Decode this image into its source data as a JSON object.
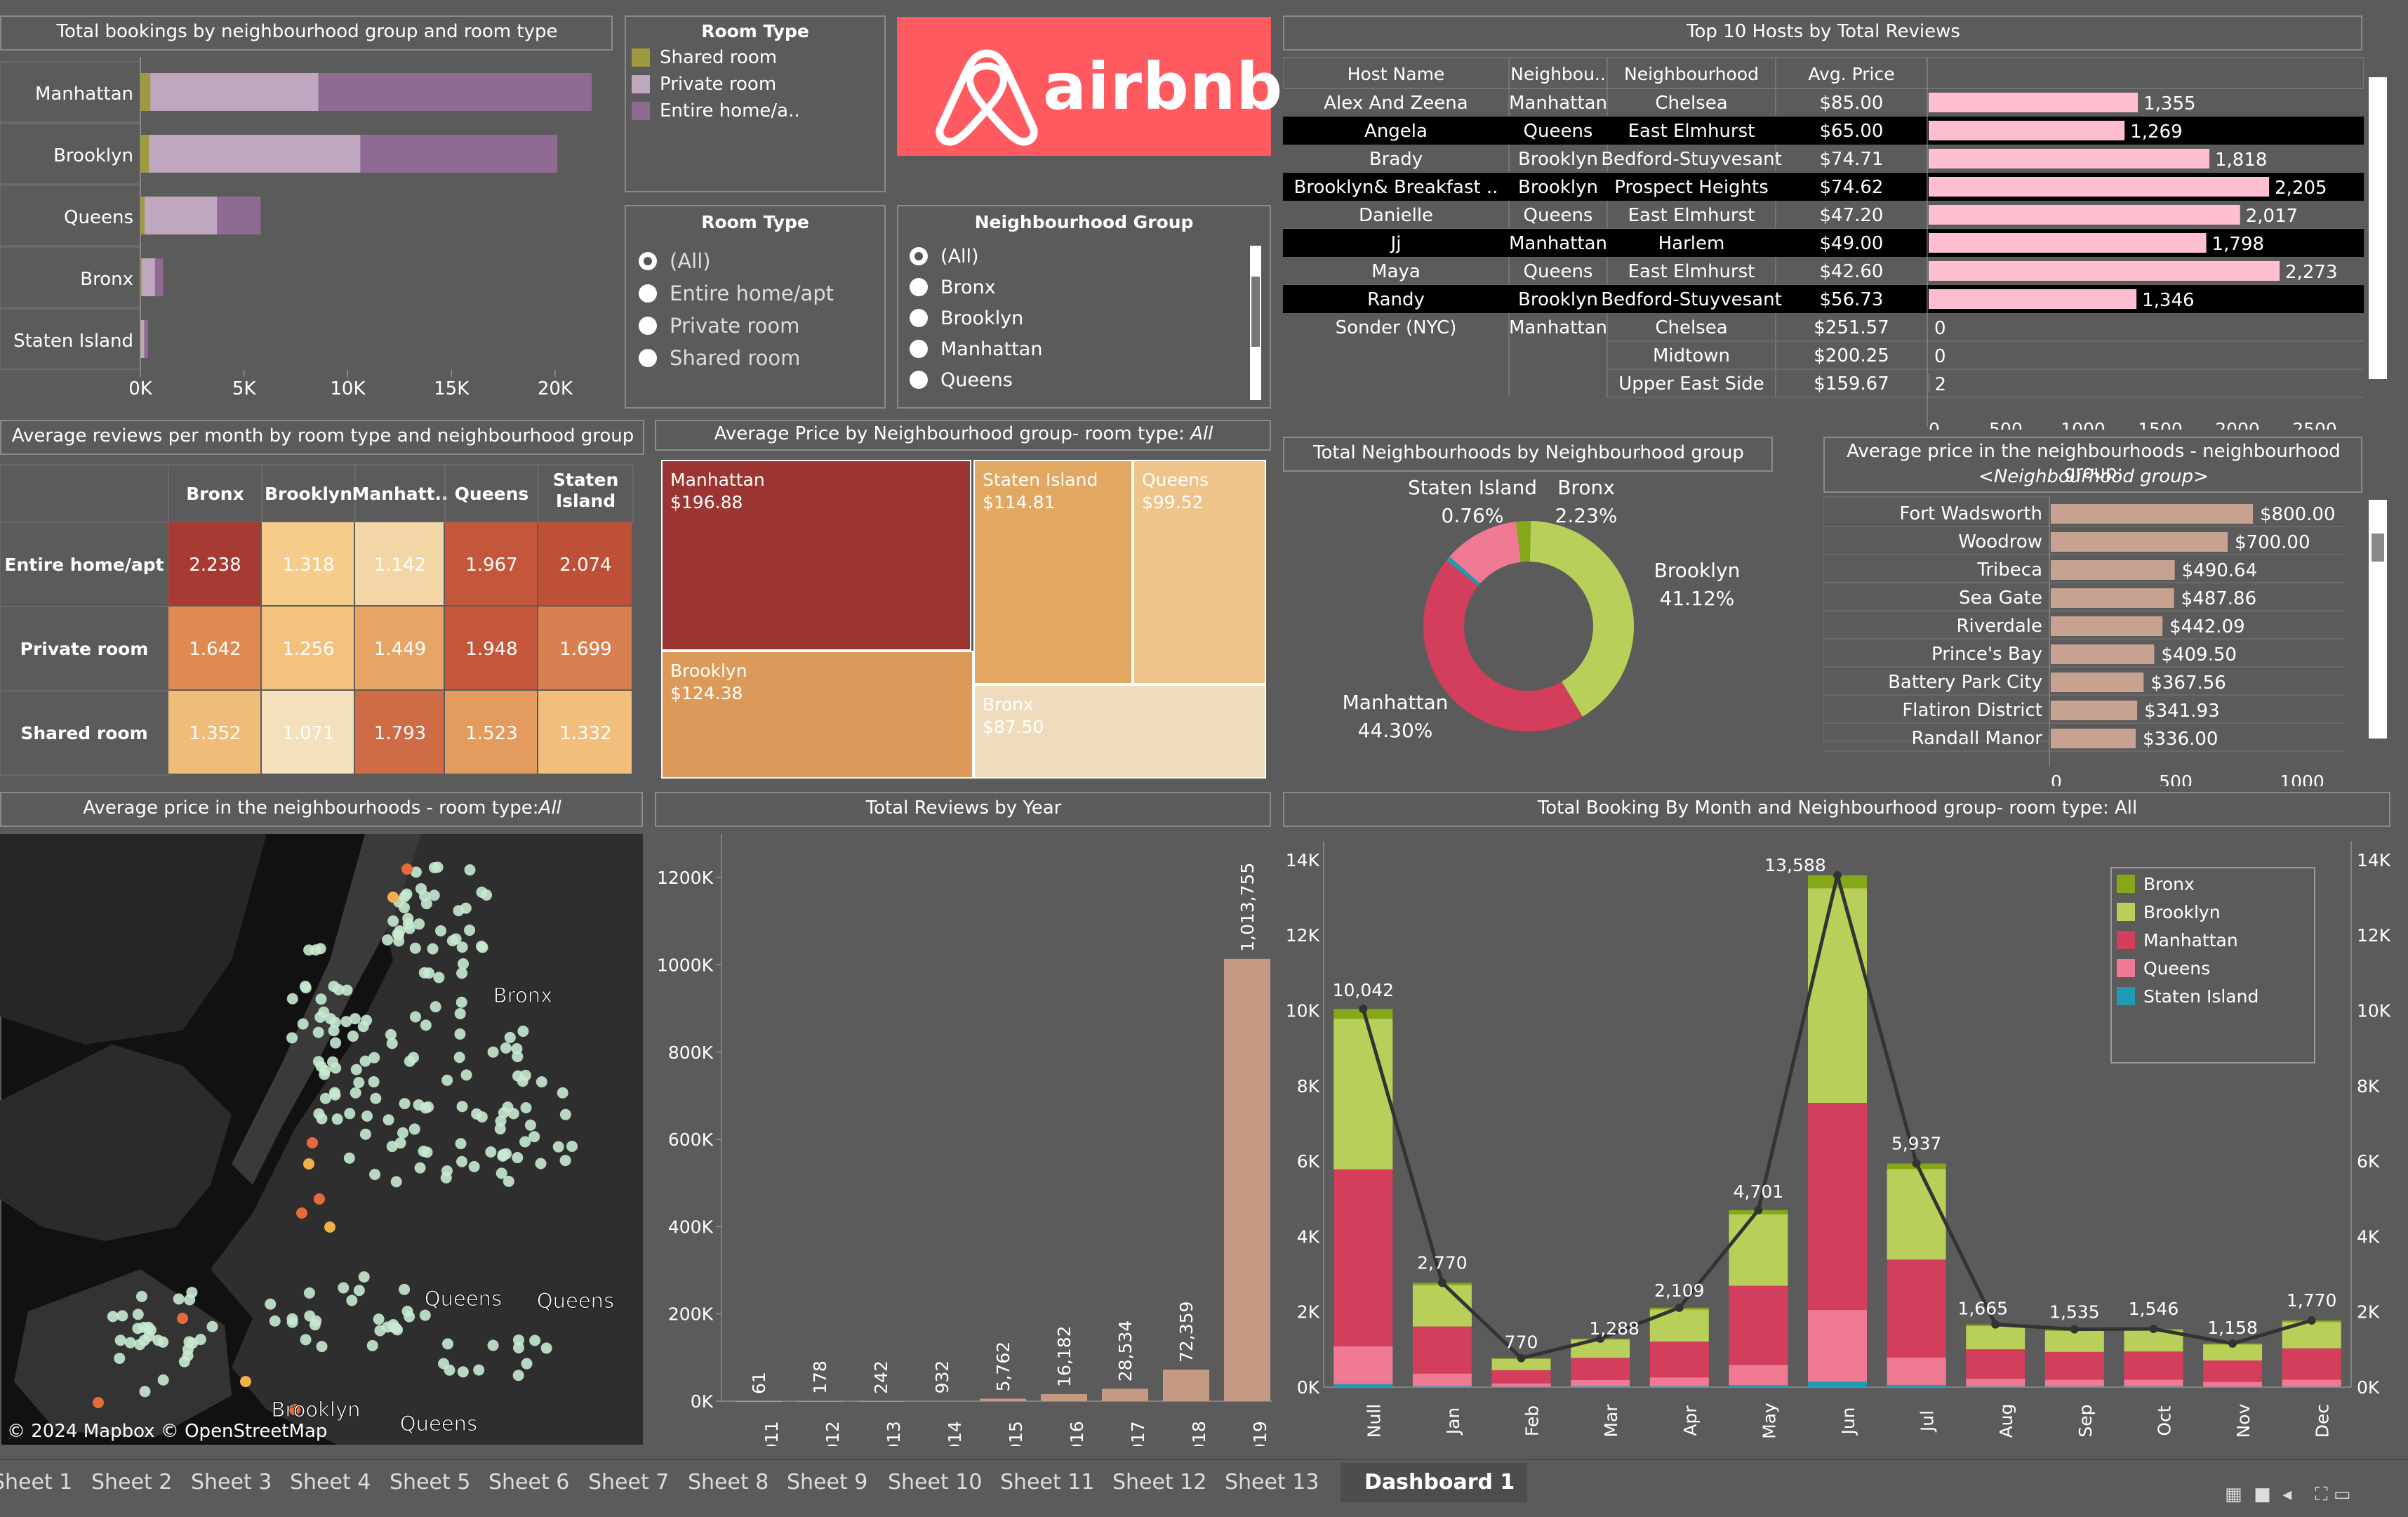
{
  "bookings": {
    "title": "Total bookings by neighbourhood group and room type",
    "legend_title": "Room Type",
    "legend": [
      "Shared room",
      "Private room",
      "Entire home/a.."
    ],
    "legend_colors": [
      "#9c9a3c",
      "#bfa7c0",
      "#8f6a92"
    ],
    "ticks": [
      "0K",
      "5K",
      "10K",
      "15K",
      "20K"
    ]
  },
  "logo": {
    "text": "airbnb",
    "bg": "#ff5a5f"
  },
  "filter_room": {
    "title": "Room Type",
    "options": [
      "(All)",
      "Entire home/apt",
      "Private room",
      "Shared room"
    ],
    "selected": "(All)"
  },
  "filter_group": {
    "title": "Neighbourhood Group",
    "options": [
      "(All)",
      "Bronx",
      "Brooklyn",
      "Manhattan",
      "Queens"
    ],
    "selected": "(All)"
  },
  "top_hosts": {
    "title": "Top 10 Hosts by Total Reviews",
    "columns": [
      "Host Name",
      "Neighbou..",
      "Neighbourhood",
      "Avg. Price"
    ],
    "rows": [
      {
        "host": "Alex And Zeena",
        "group": "Manhattan",
        "hood": "Chelsea",
        "price": "$85.00",
        "reviews": "1,355",
        "v": 1355,
        "dark": false
      },
      {
        "host": "Angela",
        "group": "Queens",
        "hood": "East Elmhurst",
        "price": "$65.00",
        "reviews": "1,269",
        "v": 1269,
        "dark": true
      },
      {
        "host": "Brady",
        "group": "Brooklyn",
        "hood": "Bedford-Stuyvesant",
        "price": "$74.71",
        "reviews": "1,818",
        "v": 1818,
        "dark": false
      },
      {
        "host": "Brooklyn&  Breakfast  ..",
        "group": "Brooklyn",
        "hood": "Prospect Heights",
        "price": "$74.62",
        "reviews": "2,205",
        "v": 2205,
        "dark": true
      },
      {
        "host": "Danielle",
        "group": "Queens",
        "hood": "East Elmhurst",
        "price": "$47.20",
        "reviews": "2,017",
        "v": 2017,
        "dark": false
      },
      {
        "host": "Jj",
        "group": "Manhattan",
        "hood": "Harlem",
        "price": "$49.00",
        "reviews": "1,798",
        "v": 1798,
        "dark": true
      },
      {
        "host": "Maya",
        "group": "Queens",
        "hood": "East Elmhurst",
        "price": "$42.60",
        "reviews": "2,273",
        "v": 2273,
        "dark": false
      },
      {
        "host": "Randy",
        "group": "Brooklyn",
        "hood": "Bedford-Stuyvesant",
        "price": "$56.73",
        "reviews": "1,346",
        "v": 1346,
        "dark": true
      },
      {
        "host": "Sonder (NYC)",
        "group": "Manhattan",
        "hood": "Chelsea",
        "price": "$251.57",
        "reviews": "0",
        "v": 0,
        "dark": false
      },
      {
        "host": "",
        "group": "",
        "hood": "Midtown",
        "price": "$200.25",
        "reviews": "0",
        "v": 0,
        "dark": false
      },
      {
        "host": "",
        "group": "",
        "hood": "Upper East Side",
        "price": "$159.67",
        "reviews": "2",
        "v": 2,
        "dark": false
      }
    ],
    "ticks": [
      "0",
      "500",
      "1000",
      "1500",
      "2000",
      "2500"
    ]
  },
  "heatmap": {
    "title": "Average reviews per month by room type and neighbourhood group",
    "cols": [
      "Bronx",
      "Brooklyn",
      "Manhatt..",
      "Queens",
      "Staten Island"
    ],
    "rows": [
      {
        "label": "Entire home/apt",
        "values": [
          "2.238",
          "1.318",
          "1.142",
          "1.967",
          "2.074"
        ],
        "colors": [
          "#a83a34",
          "#f5cc8a",
          "#f2d6a6",
          "#c4573b",
          "#bf5038"
        ]
      },
      {
        "label": "Private room",
        "values": [
          "1.642",
          "1.256",
          "1.449",
          "1.948",
          "1.699"
        ],
        "colors": [
          "#de8a52",
          "#f3c27e",
          "#e6a465",
          "#c4573b",
          "#d98050"
        ]
      },
      {
        "label": "Shared room",
        "values": [
          "1.352",
          "1.071",
          "1.793",
          "1.523",
          "1.332"
        ],
        "colors": [
          "#f0bc79",
          "#f5e0bd",
          "#cf6c45",
          "#e49c5e",
          "#f1be7c"
        ]
      }
    ]
  },
  "treemap": {
    "title_prefix": "Average Price by Neighbourhood group- room type: ",
    "title_suffix": "All",
    "cells": [
      {
        "name": "Manhattan",
        "value": "$196.88",
        "color": "#9b3531"
      },
      {
        "name": "Staten Island",
        "value": "$114.81",
        "color": "#e2a761"
      },
      {
        "name": "Queens",
        "value": "$99.52",
        "color": "#eec48a"
      },
      {
        "name": "Brooklyn",
        "value": "$124.38",
        "color": "#db9a5a"
      },
      {
        "name": "Bronx",
        "value": "$87.50",
        "color": "#eedcbd"
      }
    ]
  },
  "donut": {
    "title": "Total Neighbourhoods by Neighbourhood group",
    "slices": [
      {
        "name": "Brooklyn",
        "pct": 41.12,
        "label": "41.12%",
        "color": "#b8cf5a"
      },
      {
        "name": "Manhattan",
        "pct": 44.3,
        "label": "44.30%",
        "color": "#d23e5b"
      },
      {
        "name": "Staten Island",
        "pct": 0.76,
        "label": "0.76%",
        "color": "#1f9bb5"
      },
      {
        "name": "Queens",
        "pct": 11.59,
        "label": "",
        "color": "#f07a93"
      },
      {
        "name": "Bronx",
        "pct": 2.23,
        "label": "2.23%",
        "color": "#84a817"
      }
    ]
  },
  "avg_price_hood": {
    "title1": "Average price in the neighbourhoods - neighbourhood group:",
    "title2": "<Neighbourhood group>",
    "rows": [
      {
        "name": "Fort Wadsworth",
        "label": "$800.00",
        "v": 800
      },
      {
        "name": "Woodrow",
        "label": "$700.00",
        "v": 700
      },
      {
        "name": "Tribeca",
        "label": "$490.64",
        "v": 490.64
      },
      {
        "name": "Sea Gate",
        "label": "$487.86",
        "v": 487.86
      },
      {
        "name": "Riverdale",
        "label": "$442.09",
        "v": 442.09
      },
      {
        "name": "Prince's Bay",
        "label": "$409.50",
        "v": 409.5
      },
      {
        "name": "Battery Park City",
        "label": "$367.56",
        "v": 367.56
      },
      {
        "name": "Flatiron District",
        "label": "$341.93",
        "v": 341.93
      },
      {
        "name": "Randall Manor",
        "label": "$336.00",
        "v": 336
      }
    ],
    "ticks": [
      "0",
      "500",
      "1000"
    ]
  },
  "map": {
    "title_prefix": "Average price in the neighbourhoods - room type:",
    "title_suffix": "All",
    "labels": [
      "Bronx",
      "Queens",
      "Queens",
      "Brooklyn",
      "Queens"
    ],
    "attribution": "© 2024 Mapbox © OpenStreetMap"
  },
  "chart_data": [
    {
      "type": "bar",
      "title": "Total bookings by neighbourhood group and room type",
      "categories": [
        "Manhattan",
        "Brooklyn",
        "Queens",
        "Bronx",
        "Staten Island"
      ],
      "xlim": [
        0,
        22000
      ],
      "series": [
        {
          "name": "Shared room",
          "values": [
            480,
            410,
            200,
            60,
            10
          ]
        },
        {
          "name": "Private room",
          "values": [
            8100,
            10200,
            3500,
            650,
            180
          ]
        },
        {
          "name": "Entire home/a..",
          "values": [
            13200,
            9500,
            2100,
            380,
            180
          ]
        }
      ]
    },
    {
      "type": "bar",
      "title": "Total Reviews by Year",
      "categories": [
        "2011",
        "2012",
        "2013",
        "2014",
        "2015",
        "2016",
        "2017",
        "2018",
        "2019"
      ],
      "values": [
        61,
        178,
        242,
        932,
        5762,
        16182,
        28534,
        72359,
        1013755
      ],
      "labels": [
        "61",
        "178",
        "242",
        "932",
        "5,762",
        "16,182",
        "28,534",
        "72,359",
        "1,013,755"
      ],
      "ylim": [
        0,
        1300000
      ],
      "yticks": [
        "0K",
        "200K",
        "400K",
        "600K",
        "800K",
        "1000K",
        "1200K"
      ]
    },
    {
      "type": "bar",
      "title": "Total Booking By Month and Neighbourhood group- room type: All",
      "categories": [
        "Null",
        "Jan",
        "Feb",
        "Mar",
        "Apr",
        "May",
        "Jun",
        "Jul",
        "Aug",
        "Sep",
        "Oct",
        "Nov",
        "Dec"
      ],
      "totals": [
        10042,
        2770,
        770,
        1288,
        2109,
        4701,
        13588,
        5937,
        1665,
        1535,
        1546,
        1158,
        1770
      ],
      "total_labels": [
        "10,042",
        "2,770",
        "770",
        "1,288",
        "2,109",
        "4,701",
        "13,588",
        "5,937",
        "1,665",
        "1,535",
        "1,546",
        "1,158",
        "1,770"
      ],
      "ylim": [
        0,
        14500
      ],
      "yticks": [
        "0K",
        "2K",
        "4K",
        "6K",
        "8K",
        "10K",
        "12K",
        "14K"
      ],
      "series": [
        {
          "name": "Bronx",
          "color": "#84a817",
          "values": [
            260,
            60,
            20,
            30,
            50,
            110,
            340,
            150,
            40,
            40,
            40,
            30,
            40
          ]
        },
        {
          "name": "Brooklyn",
          "color": "#b8cf5a",
          "values": [
            4000,
            1100,
            300,
            480,
            850,
            1900,
            5700,
            2400,
            620,
            560,
            560,
            420,
            700
          ]
        },
        {
          "name": "Manhattan",
          "color": "#d23e5b",
          "values": [
            4700,
            1250,
            350,
            590,
            950,
            2100,
            5500,
            2600,
            780,
            740,
            750,
            570,
            830
          ]
        },
        {
          "name": "Queens",
          "color": "#f07a93",
          "values": [
            1000,
            340,
            90,
            170,
            240,
            540,
            1900,
            730,
            210,
            180,
            180,
            130,
            190
          ]
        },
        {
          "name": "Staten Island",
          "color": "#1f9bb5",
          "values": [
            82,
            20,
            10,
            18,
            19,
            51,
            148,
            57,
            15,
            15,
            16,
            8,
            10
          ]
        }
      ]
    }
  ],
  "tabs": [
    "Sheet 1",
    "Sheet 2",
    "Sheet 3",
    "Sheet 4",
    "Sheet 5",
    "Sheet 6",
    "Sheet 7",
    "Sheet 8",
    "Sheet 9",
    "Sheet 10",
    "Sheet 11",
    "Sheet 12",
    "Sheet 13",
    "Dashboard 1"
  ],
  "active_tab": "Dashboard 1"
}
